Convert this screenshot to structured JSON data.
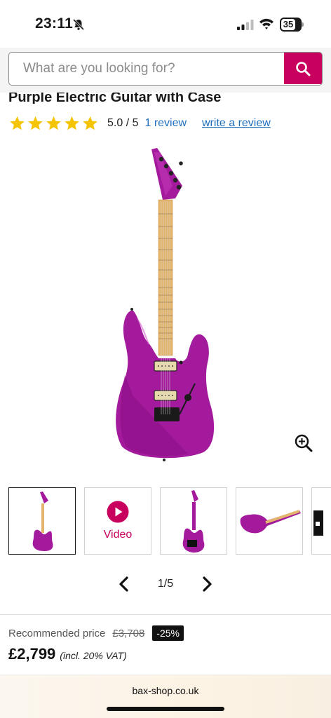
{
  "status_bar": {
    "time": "23:11",
    "battery": "35"
  },
  "search": {
    "placeholder": "What are you looking for?"
  },
  "product": {
    "title": "Purple Electric Guitar with Case",
    "rating": {
      "stars": 5,
      "score": "5.0 / 5",
      "review_count": "1 review",
      "write_review": "write a review"
    }
  },
  "gallery": {
    "thumbnails": [
      "image-1",
      "video",
      "image-3",
      "image-4",
      "image-5"
    ],
    "video_label": "Video",
    "page_indicator": "1/5"
  },
  "price": {
    "recommended_label": "Recommended price",
    "recommended_price": "£3,708",
    "discount": "-25%",
    "current_price": "£2,799",
    "vat_note": "(incl. 20% VAT)"
  },
  "browser": {
    "url": "bax-shop.co.uk"
  },
  "colors": {
    "brand": "#c8005e",
    "link": "#1f6fbd",
    "star": "#f5c400",
    "guitar_body": "#a31a9c"
  }
}
